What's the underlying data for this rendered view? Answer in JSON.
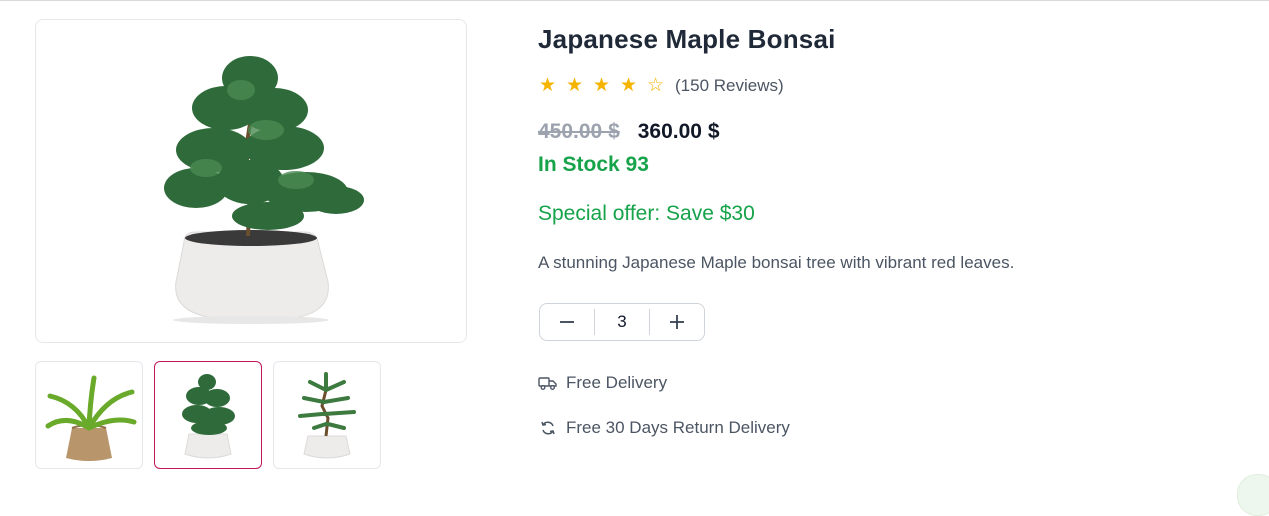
{
  "product": {
    "title": "Japanese Maple Bonsai",
    "rating": 4,
    "rating_max": 5,
    "reviews_label": "(150 Reviews)",
    "old_price": "450.00 $",
    "new_price": "360.00 $",
    "stock_label": "In Stock 93",
    "offer_label": "Special offer: Save $30",
    "description": "A stunning Japanese Maple bonsai tree with vibrant red leaves."
  },
  "quantity": {
    "value": "3",
    "minus_symbol": "−",
    "plus_symbol": "+"
  },
  "features": [
    {
      "icon": "truck-icon",
      "label": "Free Delivery"
    },
    {
      "icon": "refresh-icon",
      "label": "Free 30 Days Return Delivery"
    }
  ],
  "gallery": {
    "selected_index": 1,
    "thumbnails": [
      "staghorn-fern-in-burlap",
      "pine-bonsai-in-white-pot",
      "araucaria-bonsai-in-white-pot"
    ]
  },
  "colors": {
    "accent_green": "#16a34a",
    "star": "#f4b400",
    "active_thumb_border": "#c2185b"
  }
}
